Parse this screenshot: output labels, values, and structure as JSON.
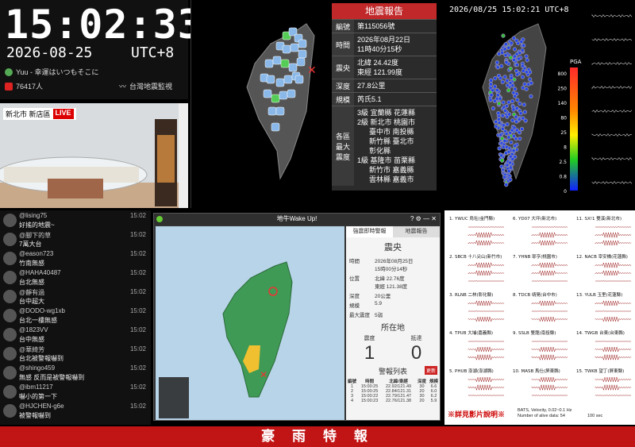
{
  "clock": {
    "time": "15:02:33",
    "date": "2026-08-25",
    "tz": "UTC+8",
    "music": "Yuu - 幸運はいつもそこに",
    "viewers": "76417人",
    "channel": "台灣地震監視"
  },
  "camera": {
    "location": "新北市 新店區",
    "live": "LIVE"
  },
  "report": {
    "title": "地震報告",
    "rows": [
      {
        "k": "編號",
        "v": "第115056號"
      },
      {
        "k": "時間",
        "v": "2026年08月22日\n11時40分15秒"
      },
      {
        "k": "震央",
        "v": "北緯 24.42度\n東經 121.99度"
      },
      {
        "k": "深度",
        "v": "27.8公里"
      },
      {
        "k": "規模",
        "v": "芮氏5.1"
      },
      {
        "k": "各區\n最大\n震度",
        "v": "3級 宜蘭縣 花蓮縣\n2級 新北市 桃園市\n      臺中市 南投縣\n      新竹縣 臺北市\n      彰化縣\n1級 基隆市 苗栗縣\n      新竹市 嘉義縣\n      雲林縣 嘉義市"
      }
    ]
  },
  "pga": {
    "timestamp": "2026/08/25 15:02:21 UTC+8",
    "label": "PGA",
    "ticks": [
      "800",
      "250",
      "140",
      "80",
      "25",
      "8",
      "2.5",
      "0.8",
      "0"
    ]
  },
  "chat": [
    {
      "name": "@lising75",
      "text": "好搖的地震~",
      "time": "15:02"
    },
    {
      "name": "@腳下的草",
      "text": "7萬大台",
      "time": "15:02"
    },
    {
      "name": "@eason723",
      "text": "竹南無感",
      "time": "15:02"
    },
    {
      "name": "@HAHA40487",
      "text": "台北無感",
      "time": "15:02"
    },
    {
      "name": "@靜有過",
      "text": "台中超大",
      "time": "15:02"
    },
    {
      "name": "@DODO-wg1xb",
      "text": "台北一樓無感",
      "time": "15:02"
    },
    {
      "name": "@1823VV",
      "text": "台中無感",
      "time": "15:02"
    },
    {
      "name": "@華綺芳",
      "text": "台北被警報嚇到",
      "time": "15:02"
    },
    {
      "name": "@shingo459",
      "text": "無感 反而是被警報嚇到",
      "time": "15:02"
    },
    {
      "name": "@ibm11217",
      "text": "嚇小的第一下",
      "time": "15:02"
    },
    {
      "name": "@HJCHEN-g6e",
      "text": "被警報嚇到",
      "time": "15:02"
    }
  ],
  "app": {
    "title": "地牛Wake Up!",
    "tab1": "強震即時警報",
    "tab2": "地震報告",
    "heading": "震央",
    "fields": [
      {
        "k": "時間",
        "v": "2026年08月25日\n15時00分14秒"
      },
      {
        "k": "位置",
        "v": "北緯 22.76度\n東經 121.38度"
      },
      {
        "k": "深度",
        "v": "20公里"
      },
      {
        "k": "規模",
        "v": "5.9"
      },
      {
        "k": "最大震度",
        "v": "5弱"
      }
    ],
    "loc_title": "所在地",
    "intensity_label": "震度",
    "eta_label": "抵達",
    "intensity": "1",
    "eta": "0",
    "list_title": "警報列表",
    "list_btn": "更新",
    "list_head": [
      "編號",
      "時間",
      "北緯/東經",
      "深度",
      "規模"
    ],
    "list": [
      [
        "1",
        "15:00:25",
        "22.92/121.49",
        "30",
        "6.6"
      ],
      [
        "2",
        "15:00:25",
        "22.84/121.31",
        "20",
        "6.0"
      ],
      [
        "3",
        "15:00:22",
        "22.79/121.47",
        "30",
        "6.2"
      ],
      [
        "4",
        "15:00:23",
        "22.76/121.38",
        "20",
        "5.9"
      ]
    ]
  },
  "wave": {
    "stations": [
      [
        "1. YWUC 烏坵(金門縣)",
        "6. YD07 大坪(新北市)",
        "11. SX!1 雙溪(新北市)"
      ],
      [
        "2. SBCB 十八尖山(新竹市)",
        "7. YHNB 耶亨(桃園市)",
        "12. NACB 宰安橋(花蓮縣)"
      ],
      [
        "3. RLNB 二林(彰化縣)",
        "8. TDCB 靖晃(台中市)",
        "13. YULB 玉里(花蓮縣)"
      ],
      [
        "4. TPUB 大埔(嘉義縣)",
        "9. SSLB 雙龍(南投縣)",
        "14. TWGB 台東(台東縣)"
      ],
      [
        "5. PHUB 澎湖(澎湖縣)",
        "10. MASB 馬仕(屏東縣)",
        "15. TWKB 望丁(屏東縣)"
      ]
    ],
    "note": "※詳見影片說明※",
    "footer1": "BATS, Velocity, 0.02~0.1 Hz",
    "footer2": "Number of alive data: 54",
    "scale": "100 sec"
  },
  "footer": "豪 雨 特 報"
}
